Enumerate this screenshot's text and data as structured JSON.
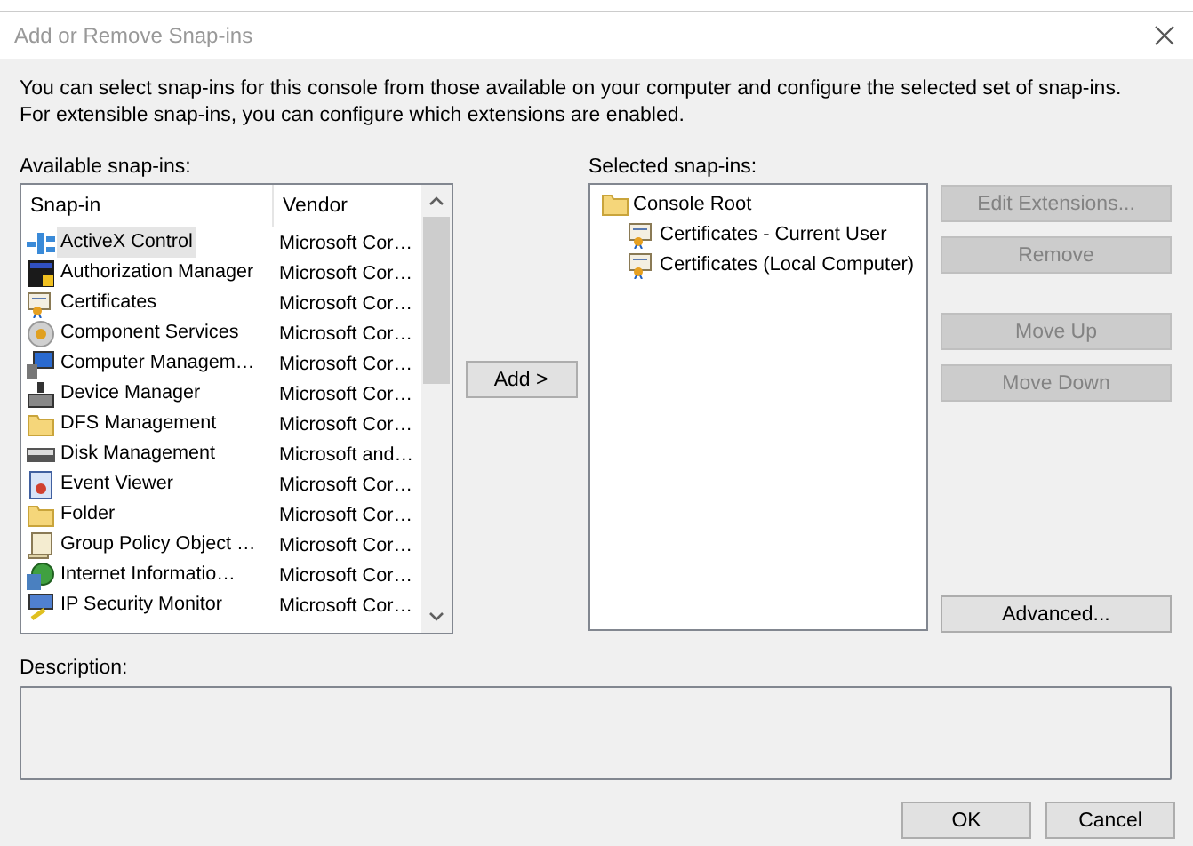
{
  "window": {
    "title": "Add or Remove Snap-ins"
  },
  "intro": "You can select snap-ins for this console from those available on your computer and configure the selected set of snap-ins. For extensible snap-ins, you can configure which extensions are enabled.",
  "available": {
    "label": "Available snap-ins:",
    "columns": [
      "Snap-in",
      "Vendor"
    ],
    "rows": [
      {
        "name": "ActiveX Control",
        "vendor": "Microsoft Cor…",
        "selected": true
      },
      {
        "name": "Authorization Manager",
        "vendor": "Microsoft Cor…",
        "selected": false
      },
      {
        "name": "Certificates",
        "vendor": "Microsoft Cor…",
        "selected": false
      },
      {
        "name": "Component Services",
        "vendor": "Microsoft Cor…",
        "selected": false
      },
      {
        "name": "Computer Managem…",
        "vendor": "Microsoft Cor…",
        "selected": false
      },
      {
        "name": "Device Manager",
        "vendor": "Microsoft Cor…",
        "selected": false
      },
      {
        "name": "DFS Management",
        "vendor": "Microsoft Cor…",
        "selected": false
      },
      {
        "name": "Disk Management",
        "vendor": "Microsoft and…",
        "selected": false
      },
      {
        "name": "Event Viewer",
        "vendor": "Microsoft Cor…",
        "selected": false
      },
      {
        "name": "Folder",
        "vendor": "Microsoft Cor…",
        "selected": false
      },
      {
        "name": "Group Policy Object …",
        "vendor": "Microsoft Cor…",
        "selected": false
      },
      {
        "name": "Internet Informatio…",
        "vendor": "Microsoft Cor…",
        "selected": false
      },
      {
        "name": "IP Security Monitor",
        "vendor": "Microsoft Cor…",
        "selected": false
      }
    ]
  },
  "add_button": {
    "label": "Add >",
    "disabled": false
  },
  "selected": {
    "label": "Selected snap-ins:",
    "tree": [
      {
        "name": "Console Root",
        "children": [
          {
            "name": "Certificates - Current User"
          },
          {
            "name": "Certificates (Local Computer)"
          }
        ]
      }
    ]
  },
  "side_buttons": [
    {
      "label": "Edit Extensions...",
      "disabled": true
    },
    {
      "label": "Remove",
      "disabled": true
    },
    {
      "label": "Move Up",
      "disabled": true
    },
    {
      "label": "Move Down",
      "disabled": true
    }
  ],
  "advanced_button": {
    "label": "Advanced...",
    "disabled": false
  },
  "description": {
    "label": "Description:"
  },
  "footer_buttons": [
    {
      "label": "OK",
      "disabled": false
    },
    {
      "label": "Cancel",
      "disabled": false
    }
  ]
}
